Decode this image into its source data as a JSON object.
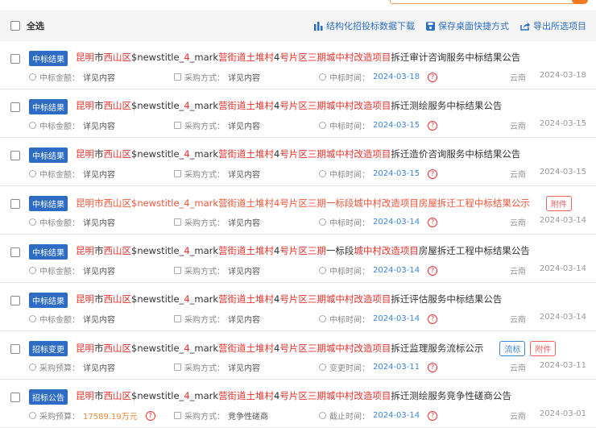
{
  "toolbar": {
    "select_all": "全选",
    "actions": [
      {
        "icon": "bar-chart-icon",
        "label": "结构化招投标数据下载"
      },
      {
        "icon": "save-icon",
        "label": "保存桌面快捷方式"
      },
      {
        "icon": "share-icon",
        "label": "导出所选项目"
      }
    ]
  },
  "colors": {
    "accent": "#2a6ec6",
    "highlight": "#e8322c",
    "tag": "#2d6bc4"
  },
  "rows": [
    {
      "tag": "中标结果",
      "visited": false,
      "segments": [
        [
          "昆明",
          1
        ],
        [
          "市",
          0
        ],
        [
          "西山区",
          1
        ],
        [
          "$newstitle_",
          0
        ],
        [
          "4",
          1
        ],
        [
          "_mark",
          0
        ],
        [
          "营街道土堆村",
          1
        ],
        [
          "4",
          0
        ],
        [
          "号片区三期城中村改造项目",
          1
        ],
        [
          "拆迁审计咨询服务中标结果公告",
          0
        ]
      ],
      "badges": [],
      "m1l": "中标金额：",
      "m1v": "详见内容",
      "m2l": "采购方式：",
      "m2v": "详见内容",
      "m3l": "中标时间：",
      "m3v": "2024-03-18",
      "region": "云南",
      "date": "2024-03-18"
    },
    {
      "tag": "中标结果",
      "visited": false,
      "segments": [
        [
          "昆明",
          1
        ],
        [
          "市",
          0
        ],
        [
          "西山区",
          1
        ],
        [
          "$newstitle_",
          0
        ],
        [
          "4",
          1
        ],
        [
          "_mark",
          0
        ],
        [
          "营街道土堆村",
          1
        ],
        [
          "4",
          0
        ],
        [
          "号片区三期城中村改造项目",
          1
        ],
        [
          "拆迁测绘服务中标结果公告",
          0
        ]
      ],
      "badges": [],
      "m1l": "中标金额：",
      "m1v": "详见内容",
      "m2l": "采购方式：",
      "m2v": "详见内容",
      "m3l": "中标时间：",
      "m3v": "2024-03-15",
      "region": "云南",
      "date": "2024-03-15"
    },
    {
      "tag": "中标结果",
      "visited": false,
      "segments": [
        [
          "昆明",
          1
        ],
        [
          "市",
          0
        ],
        [
          "西山区",
          1
        ],
        [
          "$newstitle_",
          0
        ],
        [
          "4",
          1
        ],
        [
          "_mark",
          0
        ],
        [
          "营街道土堆村",
          1
        ],
        [
          "4",
          0
        ],
        [
          "号片区三期城中村改造项目",
          1
        ],
        [
          "拆迁造价咨询服务中标结果公告",
          0
        ]
      ],
      "badges": [],
      "m1l": "中标金额：",
      "m1v": "详见内容",
      "m2l": "采购方式：",
      "m2v": "详见内容",
      "m3l": "中标时间：",
      "m3v": "2024-03-15",
      "region": "云南",
      "date": "2024-03-15"
    },
    {
      "tag": "中标结果",
      "visited": true,
      "segments": [
        [
          "昆明市西山区$newstitle_4_mark营街道土堆村4号片区三期一标段城中村改造项目房屋拆迁工程中标结果公示",
          1
        ]
      ],
      "badges": [
        {
          "label": "附件",
          "color": "#f06060"
        }
      ],
      "m1l": "中标金额：",
      "m1v": "详见内容",
      "m2l": "采购方式：",
      "m2v": "详见内容",
      "m3l": "中标时间：",
      "m3v": "2024-03-14",
      "region": "云南",
      "date": "2024-03-14"
    },
    {
      "tag": "中标结果",
      "visited": false,
      "segments": [
        [
          "昆明",
          1
        ],
        [
          "市",
          0
        ],
        [
          "西山区",
          1
        ],
        [
          "$newstitle_",
          0
        ],
        [
          "4",
          1
        ],
        [
          "_mark",
          0
        ],
        [
          "营街道土堆村",
          1
        ],
        [
          "4",
          0
        ],
        [
          "号片区三期",
          1
        ],
        [
          "一标段",
          0
        ],
        [
          "城中村改造项目",
          1
        ],
        [
          "房屋拆迁工程中标结果公告",
          0
        ]
      ],
      "badges": [],
      "m1l": "中标金额：",
      "m1v": "详见内容",
      "m2l": "采购方式：",
      "m2v": "详见内容",
      "m3l": "中标时间：",
      "m3v": "2024-03-14",
      "region": "云南",
      "date": "2024-03-14"
    },
    {
      "tag": "中标结果",
      "visited": false,
      "segments": [
        [
          "昆明",
          1
        ],
        [
          "市",
          0
        ],
        [
          "西山区",
          1
        ],
        [
          "$newstitle_",
          0
        ],
        [
          "4",
          1
        ],
        [
          "_mark",
          0
        ],
        [
          "营街道土堆村",
          1
        ],
        [
          "4",
          0
        ],
        [
          "号片区三期城中村改造项目",
          1
        ],
        [
          "拆迁评估服务中标结果公告",
          0
        ]
      ],
      "badges": [],
      "m1l": "中标金额：",
      "m1v": "详见内容",
      "m2l": "采购方式：",
      "m2v": "详见内容",
      "m3l": "中标时间：",
      "m3v": "2024-03-14",
      "region": "云南",
      "date": "2024-03-14"
    },
    {
      "tag": "招标变更",
      "visited": false,
      "segments": [
        [
          "昆明",
          1
        ],
        [
          "市",
          0
        ],
        [
          "西山区",
          1
        ],
        [
          "$newstitle_",
          0
        ],
        [
          "4",
          1
        ],
        [
          "_mark",
          0
        ],
        [
          "营街道土堆村",
          1
        ],
        [
          "4",
          0
        ],
        [
          "号片区三期城中村改造项目",
          1
        ],
        [
          "拆迁监理服务流标公示",
          0
        ]
      ],
      "badges": [
        {
          "label": "流标",
          "color": "#3a86d8"
        },
        {
          "label": "附件",
          "color": "#f06060"
        }
      ],
      "m1l": "采购预算：",
      "m1v": "详见内容",
      "m2l": "采购方式：",
      "m2v": "详见内容",
      "m3l": "变更时间：",
      "m3v": "2024-03-11",
      "region": "云南",
      "date": "2024-03-11"
    },
    {
      "tag": "招标公告",
      "visited": false,
      "segments": [
        [
          "昆明",
          1
        ],
        [
          "市",
          0
        ],
        [
          "西山区",
          1
        ],
        [
          "$newstitle_",
          0
        ],
        [
          "4",
          1
        ],
        [
          "_mark",
          0
        ],
        [
          "营街道土堆村",
          1
        ],
        [
          "4",
          0
        ],
        [
          "号片区三期城中村改造项目",
          1
        ],
        [
          "拆迁测绘服务竞争性磋商公告",
          0
        ]
      ],
      "badges": [],
      "m1l": "采购预算：",
      "m1v": "17589.19万元",
      "m1orange": true,
      "m2l": "采购方式：",
      "m2v": "竞争性磋商",
      "m3l": "截止时间：",
      "m3v": "2024-03-14",
      "region": "云南",
      "date": "2024-03-01"
    }
  ]
}
